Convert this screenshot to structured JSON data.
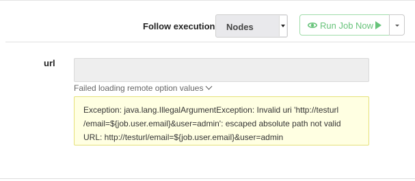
{
  "toolbar": {
    "follow_label": "Follow execution",
    "follow_select_value": "Nodes",
    "run_button_label": "Run Job Now",
    "accent_color": "#67c37a"
  },
  "option": {
    "name": "url",
    "value": "",
    "status_link": "Failed loading remote option values",
    "error_lines": [
      "Exception: java.lang.IllegalArgumentException: Invalid uri 'http://testurl",
      "/email=${job.user.email}&user=admin': escaped absolute path not valid",
      "URL: http://testurl/email=${job.user.email}&user=admin"
    ],
    "error_background": "#ffffe2",
    "error_border": "#e5e17a"
  },
  "icons": {
    "run": "eye-icon",
    "play": "play-icon",
    "caret": "caret-down-icon",
    "chevron": "chevron-down-icon"
  }
}
